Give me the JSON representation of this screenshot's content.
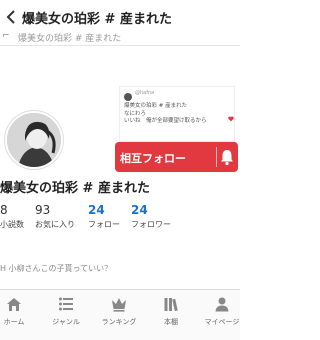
{
  "header": {
    "title": "爆美女の珀彩 # 産まれた"
  },
  "subbar": {
    "text": "爆美女の珀彩 # 産まれた"
  },
  "header_card": {
    "handle": "@hafna",
    "line1": "爆美女の珀彩 # 産まれた",
    "line2": "なにわろ",
    "line3": "いいね　俺が全部要望け取るから"
  },
  "profile": {
    "name": "爆美女の珀彩 # 産まれた",
    "follow_label": "相互フォロー",
    "bio": "H 小柳さんこの子貰っていい？"
  },
  "stats": [
    {
      "value": "8",
      "label": "小説数"
    },
    {
      "value": "93",
      "label": "お気に入り"
    },
    {
      "value": "24",
      "label": "フォロー"
    },
    {
      "value": "24",
      "label": "フォロワー"
    }
  ],
  "tabs": [
    {
      "label": "ホーム",
      "icon": "home-icon"
    },
    {
      "label": "ジャンル",
      "icon": "genre-list-icon"
    },
    {
      "label": "ランキング",
      "icon": "ranking-crown-icon"
    },
    {
      "label": "本棚",
      "icon": "bookshelf-icon"
    },
    {
      "label": "マイページ",
      "icon": "mypage-person-icon"
    }
  ],
  "colors": {
    "accent": "#e2383f",
    "link_blue": "#1a73c8"
  }
}
